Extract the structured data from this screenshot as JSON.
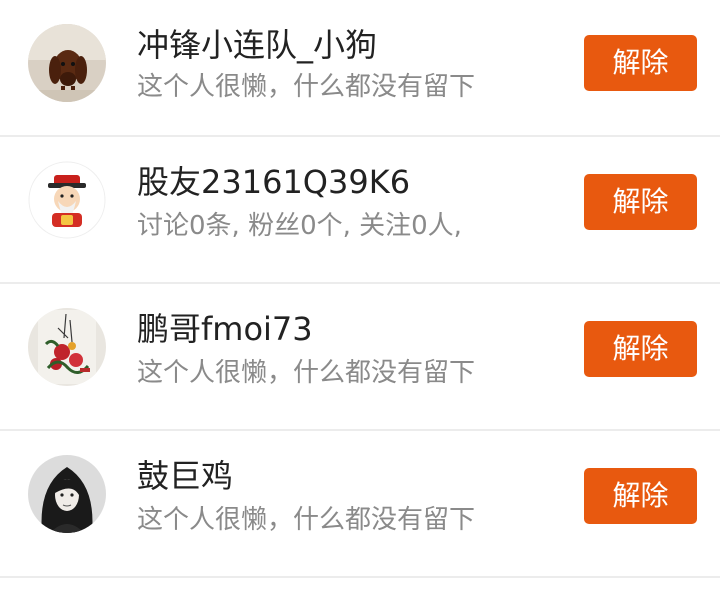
{
  "users": [
    {
      "name": "冲锋小连队_小狗",
      "description": "这个人很懒，什么都没有留下",
      "action_label": "解除",
      "avatar": "dachshund-dog-photo-icon"
    },
    {
      "name": "股友23161Q39K6",
      "description": "讨论0条, 粉丝0个, 关注0人,",
      "action_label": "解除",
      "avatar": "fortune-god-cartoon-icon"
    },
    {
      "name": "鹏哥fmoi73",
      "description": "这个人很懒，什么都没有留下",
      "action_label": "解除",
      "avatar": "flower-painting-icon"
    },
    {
      "name": "鼓巨鸡",
      "description": "这个人很懒，什么都没有留下",
      "action_label": "解除",
      "avatar": "woman-portrait-photo-icon"
    }
  ],
  "colors": {
    "button": "#e8590f",
    "name_text": "#222222",
    "desc_text": "#8a8a8a",
    "divider": "#ececec"
  }
}
